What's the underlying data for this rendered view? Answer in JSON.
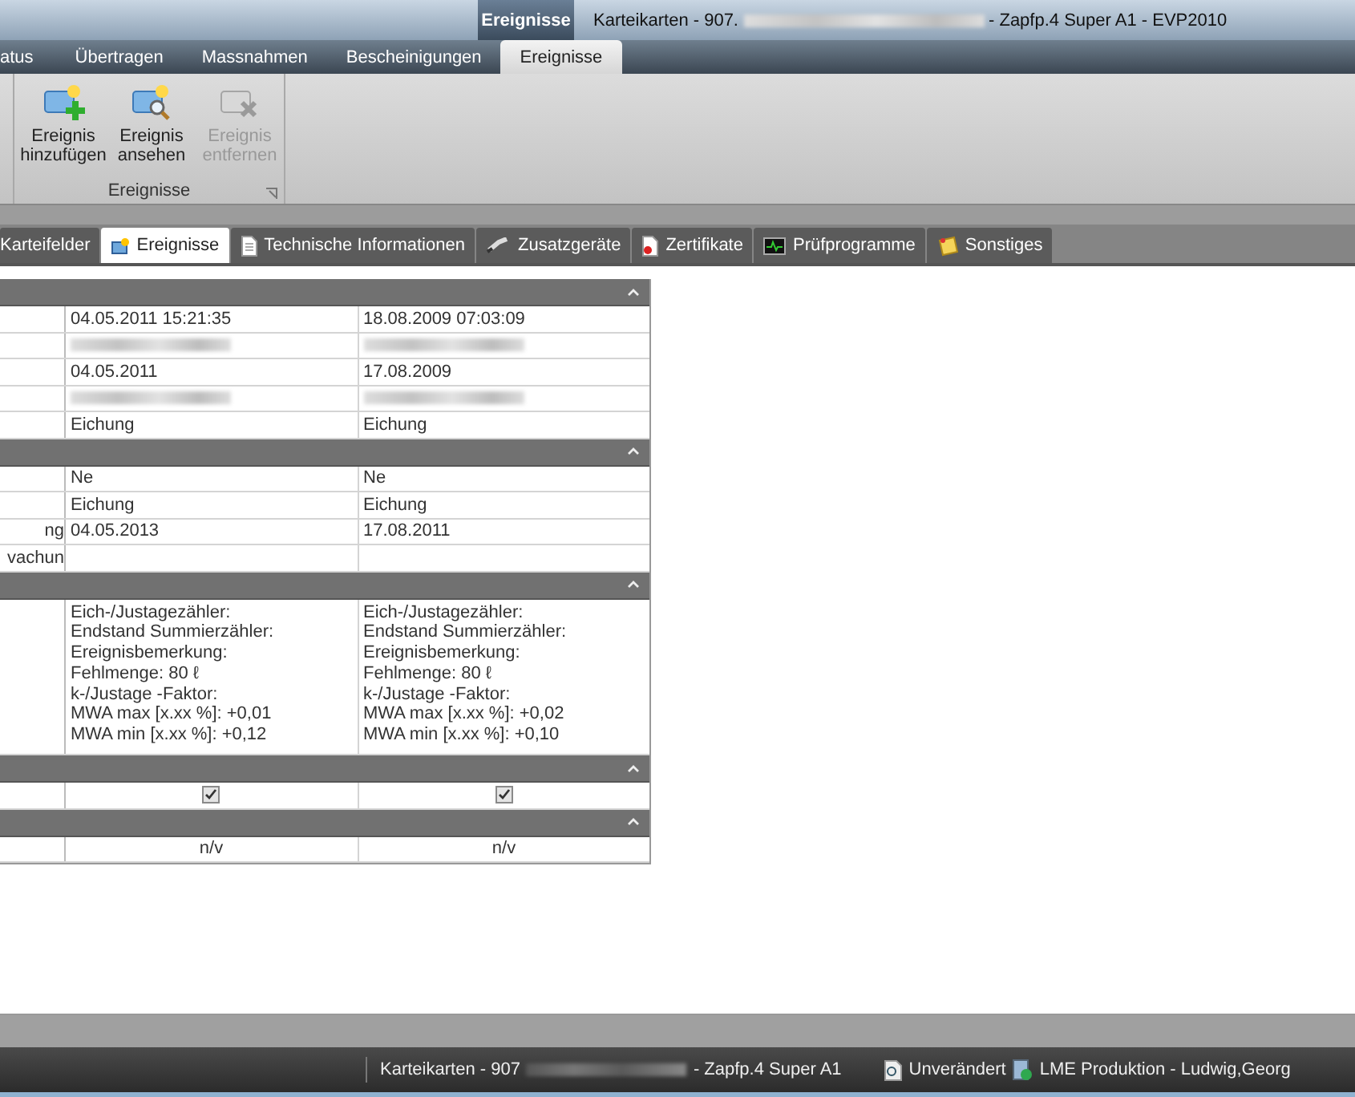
{
  "title_bar": {
    "context_tab": "Ereignisse",
    "title_start": "Karteikarten - 907.",
    "title_end": "- Zapfp.4 Super A1 - EVP2010"
  },
  "ribbon_tabs": [
    {
      "label": "atus",
      "selected": false
    },
    {
      "label": "Übertragen",
      "selected": false
    },
    {
      "label": "Massnahmen",
      "selected": false
    },
    {
      "label": "Bescheinigungen",
      "selected": false
    },
    {
      "label": "Ereignisse",
      "selected": true
    }
  ],
  "ribbon_group": {
    "label": "Ereignisse",
    "buttons": [
      {
        "kind": "add",
        "label": "Ereignis hinzufügen",
        "disabled": false
      },
      {
        "kind": "view",
        "label": "Ereignis ansehen",
        "disabled": false
      },
      {
        "kind": "remove",
        "label": "Ereignis entfernen",
        "disabled": true
      }
    ]
  },
  "doc_tabs": [
    {
      "kind": "none",
      "label": "Karteifelder",
      "selected": false
    },
    {
      "kind": "event",
      "label": "Ereignisse",
      "selected": true
    },
    {
      "kind": "document",
      "label": "Technische Informationen",
      "selected": false
    },
    {
      "kind": "device",
      "label": "Zusatzgeräte",
      "selected": false
    },
    {
      "kind": "certificate",
      "label": "Zertifikate",
      "selected": false
    },
    {
      "kind": "monitor",
      "label": "Prüfprogramme",
      "selected": false
    },
    {
      "kind": "note",
      "label": "Sonstiges",
      "selected": false
    }
  ],
  "sections": [
    {
      "rows": [
        {
          "cells": [
            {
              "kind": "text",
              "text": "04.05.2011 15:21:35"
            },
            {
              "kind": "text",
              "text": "18.08.2009 07:03:09"
            }
          ]
        },
        {
          "cells": [
            {
              "kind": "blurred"
            },
            {
              "kind": "blurred"
            }
          ]
        },
        {
          "cells": [
            {
              "kind": "text",
              "text": "04.05.2011"
            },
            {
              "kind": "text",
              "text": "17.08.2009"
            }
          ]
        },
        {
          "cells": [
            {
              "kind": "blurred"
            },
            {
              "kind": "blurred"
            }
          ]
        },
        {
          "cells": [
            {
              "kind": "text",
              "text": "Eichung"
            },
            {
              "kind": "text",
              "text": "Eichung"
            }
          ]
        }
      ]
    },
    {
      "rows": [
        {
          "cells": [
            {
              "kind": "text",
              "text": "Ne"
            },
            {
              "kind": "text",
              "text": "Ne"
            }
          ]
        },
        {
          "cells": [
            {
              "kind": "text",
              "text": "Eichung"
            },
            {
              "kind": "text",
              "text": "Eichung"
            }
          ]
        },
        {
          "label": "ng",
          "cells": [
            {
              "kind": "text",
              "text": "04.05.2013"
            },
            {
              "kind": "text",
              "text": "17.08.2011"
            }
          ]
        },
        {
          "label": "vachun",
          "cells": [
            {
              "kind": "empty"
            },
            {
              "kind": "empty"
            }
          ]
        }
      ]
    },
    {
      "rows": [
        {
          "cells": [
            {
              "kind": "lines",
              "lines": [
                "Eich-/Justagezähler:",
                "Endstand Summierzähler:",
                "Ereignisbemerkung:",
                "Fehlmenge: 80 ℓ",
                "k-/Justage -Faktor:",
                "MWA max [x.xx %]: +0,01",
                "MWA min  [x.xx %]: +0,12"
              ]
            },
            {
              "kind": "lines",
              "lines": [
                "Eich-/Justagezähler:",
                "Endstand Summierzähler:",
                "Ereignisbemerkung:",
                "Fehlmenge: 80 ℓ",
                "k-/Justage -Faktor:",
                "MWA max [x.xx %]: +0,02",
                "MWA min  [x.xx %]: +0,10"
              ]
            }
          ]
        }
      ]
    },
    {
      "rows": [
        {
          "cells": [
            {
              "kind": "checkbox",
              "checked": true
            },
            {
              "kind": "checkbox",
              "checked": true
            }
          ]
        }
      ]
    },
    {
      "rows": [
        {
          "cells": [
            {
              "kind": "center",
              "text": "n/v"
            },
            {
              "kind": "center",
              "text": "n/v"
            }
          ]
        }
      ]
    }
  ],
  "status_bar": {
    "title_start": "Karteikarten - 907",
    "title_end": "- Zapfp.4 Super A1",
    "state": "Unverändert",
    "user": "LME Produktion - Ludwig,Georg"
  }
}
